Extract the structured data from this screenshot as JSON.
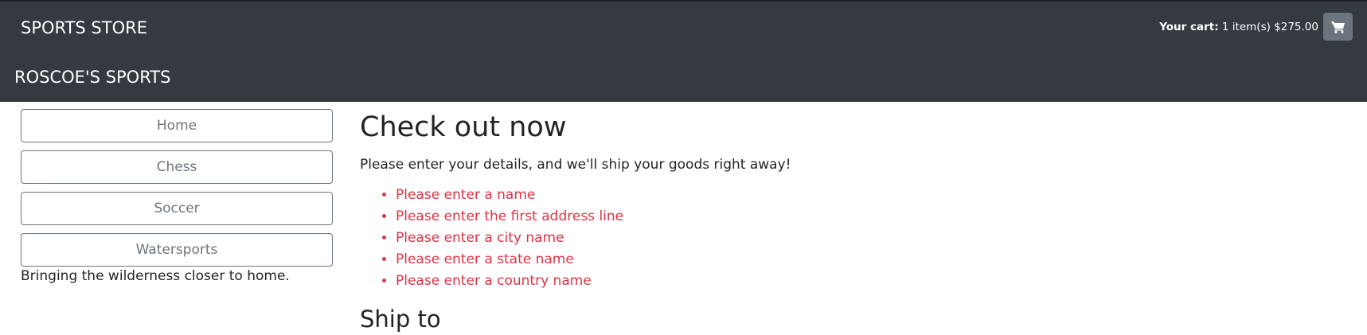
{
  "navbar": {
    "brand": "SPORTS STORE",
    "cart_label": "Your cart:",
    "cart_summary": "1 item(s) $275.00",
    "cart_icon": "shopping-cart-icon"
  },
  "store": {
    "name": "ROSCOE'S SPORTS"
  },
  "sidebar": {
    "categories": [
      "Home",
      "Chess",
      "Soccer",
      "Watersports"
    ],
    "tagline": "Bringing the wilderness closer to home."
  },
  "main": {
    "heading": "Check out now",
    "lead": "Please enter your details, and we'll ship your goods right away!",
    "errors": [
      "Please enter a name",
      "Please enter the first address line",
      "Please enter a city name",
      "Please enter a state name",
      "Please enter a country name"
    ],
    "ship_heading": "Ship to"
  },
  "colors": {
    "navbar_bg": "#343a40",
    "error_text": "#dc3545",
    "outline_button": "#6c757d"
  }
}
